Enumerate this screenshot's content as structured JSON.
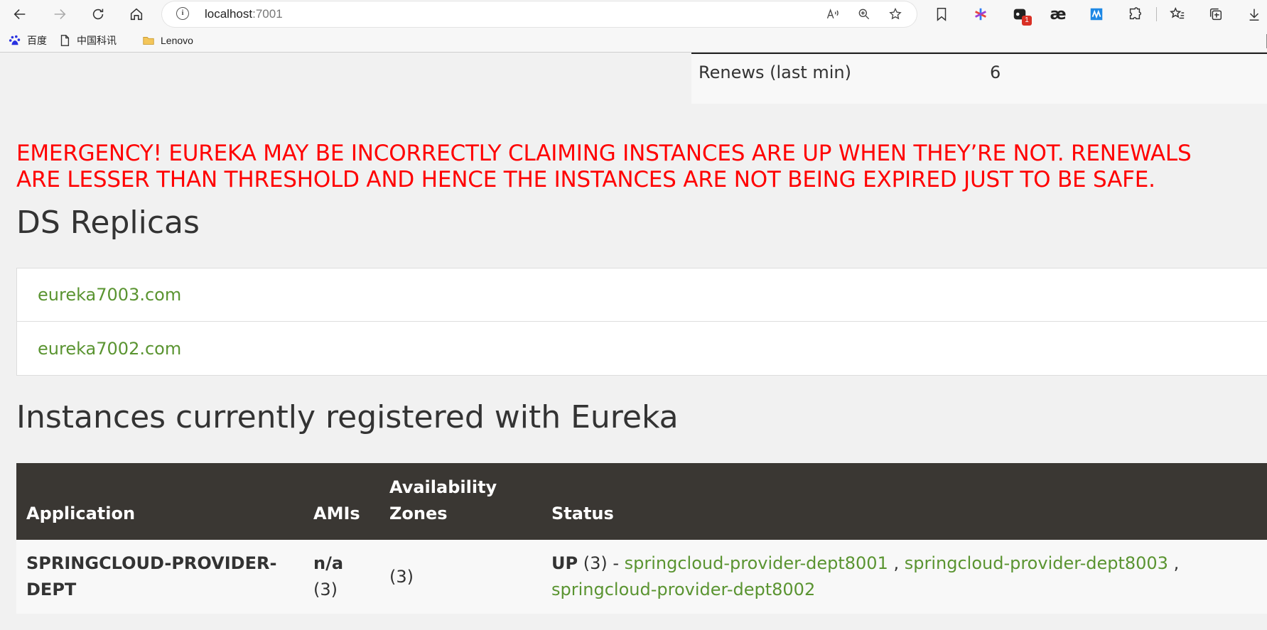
{
  "browser": {
    "url_host": "localhost",
    "url_port": ":7001",
    "extension_badge": "1",
    "ae_icon": "æ",
    "bookmarks": [
      {
        "label": "百度",
        "icon": "baidu-icon"
      },
      {
        "label": "中国科讯",
        "icon": "page-icon"
      },
      {
        "label": "Lenovo",
        "icon": "folder-icon"
      }
    ]
  },
  "status": {
    "renews_label": "Renews (last min)",
    "renews_value": "6"
  },
  "emergency": {
    "line1": "EMERGENCY! EUREKA MAY BE INCORRECTLY CLAIMING INSTANCES ARE UP WHEN THEY’RE NOT. RENEWALS",
    "line2": "ARE LESSER THAN THRESHOLD AND HENCE THE INSTANCES ARE NOT BEING EXPIRED JUST TO BE SAFE."
  },
  "replicas": {
    "title": "DS Replicas",
    "items": [
      "eureka7003.com",
      "eureka7002.com"
    ]
  },
  "instances": {
    "title": "Instances currently registered with Eureka",
    "headers": {
      "application": "Application",
      "amis": "AMIs",
      "zones_line1": "Availability",
      "zones_line2": "Zones",
      "status": "Status"
    },
    "rows": [
      {
        "app_line1": "SPRINGCLOUD-PROVIDER-",
        "app_line2": "DEPT",
        "ami_line1": "n/a",
        "ami_line2": "(3)",
        "zones": "(3)",
        "status_state": "UP",
        "status_count": " (3) - ",
        "instance1": "springcloud-provider-dept8001",
        "sep1": " , ",
        "instance2": "springcloud-provider-dept8003",
        "sep2": " ,",
        "instance3": "springcloud-provider-dept8002"
      }
    ]
  }
}
